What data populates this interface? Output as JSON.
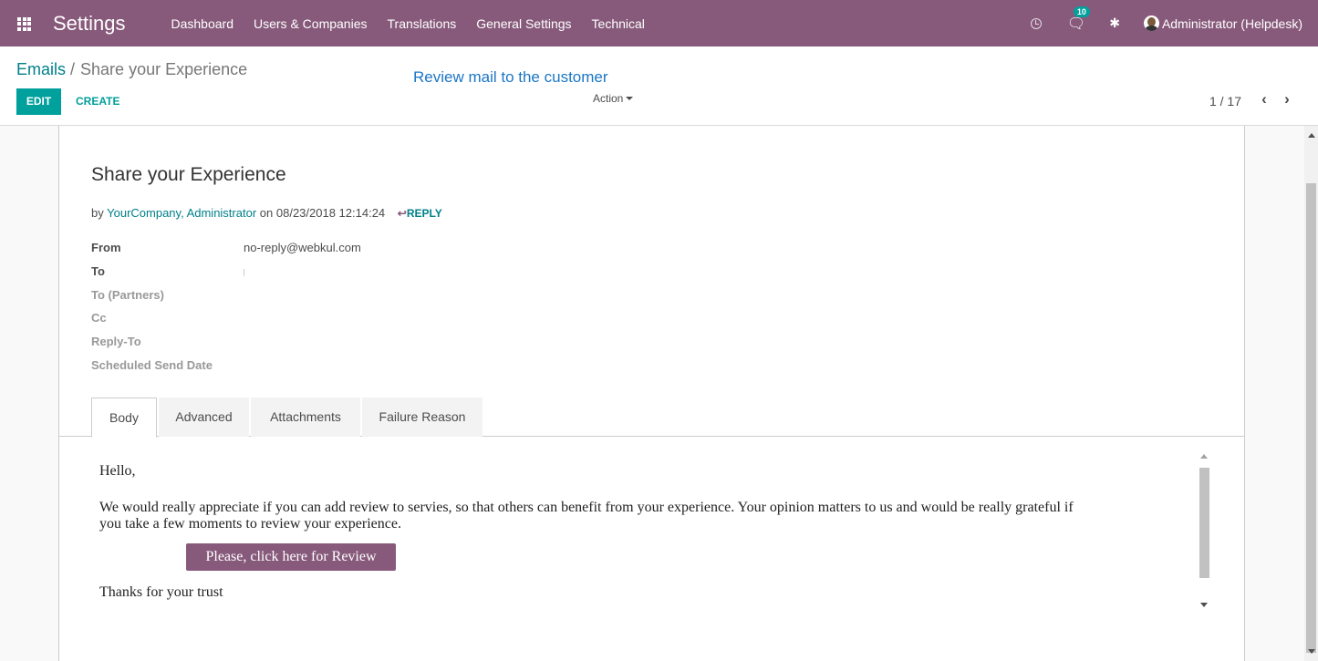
{
  "navbar": {
    "brand": "Settings",
    "menu": [
      "Dashboard",
      "Users & Companies",
      "Translations",
      "General Settings",
      "Technical"
    ],
    "messages_count": "10",
    "user": "Administrator (Helpdesk)",
    "icons": [
      "apps-grid-icon",
      "clock-icon",
      "chat-icon",
      "bug-icon",
      "avatar"
    ],
    "color": "#875a7b"
  },
  "control_panel": {
    "breadcrumb_parent": "Emails",
    "breadcrumb_separator": "/",
    "breadcrumb_current": "Share your Experience",
    "annotation": "Review mail to the customer",
    "edit_label": "EDIT",
    "create_label": "CREATE",
    "action_label": "Action",
    "pager": "1 / 17",
    "prev_symbol": "‹",
    "next_symbol": "›",
    "accent": "#00a09d"
  },
  "message": {
    "subject": "Share your Experience",
    "by_prefix": "by",
    "author": "YourCompany, Administrator",
    "date_prefix": "on",
    "date": "08/23/2018 12:14:24",
    "reply_label": "REPLY",
    "reply_icon": "↩",
    "fields": {
      "from_label": "From",
      "from_value": "no-reply@webkul.com",
      "to_label": "To",
      "to_partners_label": "To (Partners)",
      "cc_label": "Cc",
      "reply_to_label": "Reply-To",
      "scheduled_label": "Scheduled Send Date"
    }
  },
  "tabs": [
    "Body",
    "Advanced",
    "Attachments",
    "Failure Reason"
  ],
  "body": {
    "greeting": "Hello,",
    "paragraph_line1": "We would really appreciate if you can add review to servies, so that others can benefit from your experience. Your opinion matters to us and would be really grateful if",
    "paragraph_line2": "you take a few moments to review your experience.",
    "button_label": "Please, click here for Review",
    "closing": "Thanks for your trust"
  }
}
